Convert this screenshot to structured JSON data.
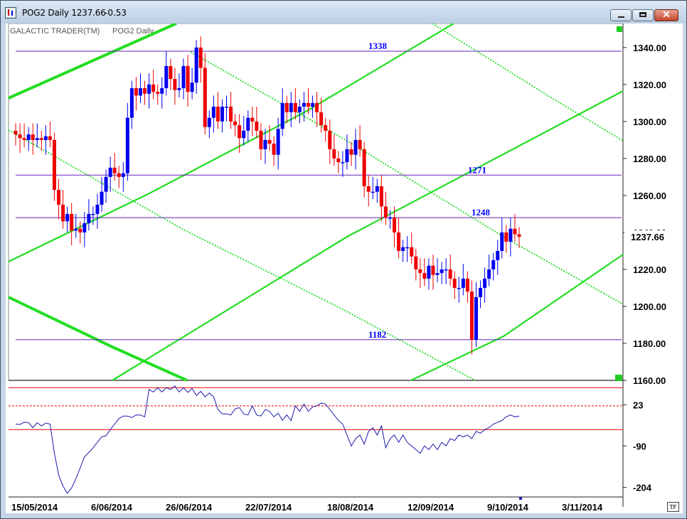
{
  "window": {
    "title": "POG2 Daily 1237.66",
    "change": "-0.53",
    "minimize_icon": "minimize-icon",
    "maximize_icon": "maximize-icon",
    "close_icon": "close-icon",
    "close_glyph": "✕",
    "tf_label": "TF"
  },
  "legend": {
    "source": "GALACTIC TRADER(TM)",
    "series": "POG2 Daily"
  },
  "colors": {
    "up_candle": "#0000ee",
    "down_candle": "#ee0000",
    "green_line": "#22dd22",
    "level_line": "#6622bb",
    "oscillator": "#1a1aaa",
    "osc_band": "#ee0000"
  },
  "chart_data": [
    {
      "type": "candlestick",
      "series_name": "POG2 Daily",
      "last_value": "1237.66",
      "y_ticks": [
        "1340.00",
        "1320.00",
        "1300.00",
        "1280.00",
        "1260.00",
        "1240.00",
        "1220.00",
        "1200.00",
        "1180.00",
        "1160.00"
      ],
      "ylim": [
        1160,
        1353
      ],
      "levels": [
        {
          "value": 1338,
          "label": "1338"
        },
        {
          "value": 1271,
          "label": "1271"
        },
        {
          "value": 1248,
          "label": "1248"
        },
        {
          "value": 1182,
          "label": "1182"
        }
      ],
      "closes": [
        1293,
        1291,
        1290,
        1293,
        1290,
        1291,
        1290,
        1292,
        1290,
        1263,
        1255,
        1246,
        1250,
        1241,
        1242,
        1240,
        1245,
        1250,
        1250,
        1255,
        1262,
        1270,
        1275,
        1272,
        1270,
        1272,
        1302,
        1318,
        1314,
        1318,
        1315,
        1320,
        1316,
        1315,
        1318,
        1330,
        1323,
        1317,
        1318,
        1330,
        1316,
        1321,
        1340,
        1329,
        1297,
        1302,
        1308,
        1300,
        1308,
        1308,
        1300,
        1298,
        1291,
        1295,
        1302,
        1300,
        1295,
        1285,
        1290,
        1288,
        1282,
        1296,
        1310,
        1305,
        1310,
        1305,
        1308,
        1310,
        1308,
        1310,
        1305,
        1298,
        1295,
        1285,
        1280,
        1278,
        1278,
        1285,
        1282,
        1290,
        1285,
        1265,
        1262,
        1262,
        1265,
        1254,
        1248,
        1248,
        1240,
        1230,
        1232,
        1232,
        1227,
        1220,
        1218,
        1215,
        1222,
        1217,
        1218,
        1220,
        1220,
        1215,
        1210,
        1210,
        1215,
        1208,
        1182,
        1205,
        1210,
        1215,
        1220,
        1225,
        1230,
        1240,
        1235,
        1242,
        1239,
        1237.66
      ],
      "x_ticks": [
        "15/05/2014",
        "6/06/2014",
        "26/06/2014",
        "22/07/2014",
        "18/08/2014",
        "12/09/2014",
        "9/10/2014",
        "3/11/2014"
      ]
    },
    {
      "type": "line",
      "series_name": "oscillator",
      "y_ticks": [
        "23",
        "-90",
        "-204"
      ],
      "ylim": [
        -230,
        90
      ],
      "bands": [
        {
          "value": 70,
          "style": "solid"
        },
        {
          "value": 20,
          "style": "dashed"
        },
        {
          "value": -45,
          "style": "solid"
        }
      ],
      "values": [
        -30,
        -31,
        -25,
        -26,
        -40,
        -26,
        -35,
        -27,
        -30,
        -110,
        -170,
        -200,
        -220,
        -205,
        -180,
        -150,
        -120,
        -108,
        -95,
        -80,
        -65,
        -62,
        -45,
        -30,
        -15,
        -8,
        -8,
        -12,
        -5,
        -5,
        -10,
        65,
        58,
        70,
        58,
        70,
        65,
        75,
        58,
        70,
        57,
        68,
        48,
        60,
        45,
        55,
        45,
        10,
        -2,
        -2,
        -5,
        12,
        15,
        -2,
        -5,
        20,
        -5,
        -8,
        10,
        5,
        -10,
        0,
        -20,
        -5,
        -20,
        20,
        5,
        25,
        5,
        17,
        20,
        28,
        25,
        10,
        -5,
        -20,
        -30,
        -60,
        -90,
        -70,
        -60,
        -85,
        -50,
        -40,
        -60,
        -35,
        -95,
        -70,
        -60,
        -80,
        -60,
        -80,
        -90,
        -100,
        -110,
        -90,
        -100,
        -85,
        -100,
        -80,
        -90,
        -70,
        -75,
        -60,
        -65,
        -60,
        -70,
        -50,
        -55,
        -45,
        -40,
        -30,
        -25,
        -20,
        -10,
        -5,
        -10,
        -8
      ],
      "x_ticks": [
        "15/05/2014",
        "6/06/2014",
        "26/06/2014",
        "22/07/2014",
        "18/08/2014",
        "12/09/2014",
        "9/10/2014",
        "3/11/2014"
      ]
    }
  ]
}
